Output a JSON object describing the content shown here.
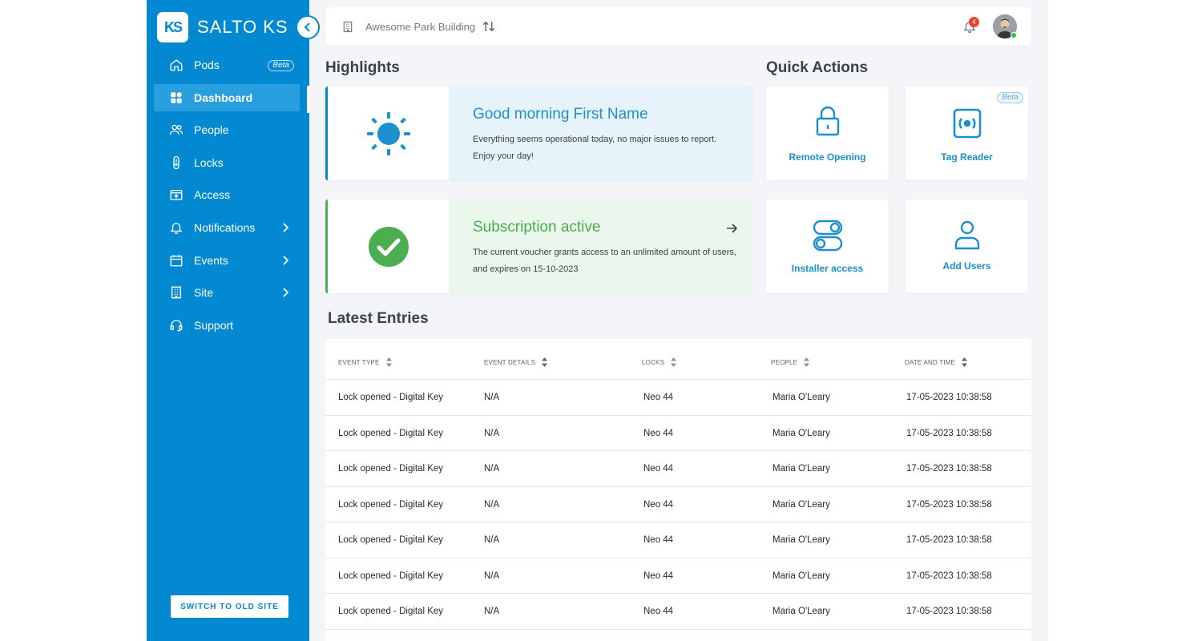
{
  "brand": {
    "logo_mark": "KS",
    "name": "SALTO KS"
  },
  "sidebar": {
    "items": [
      {
        "label": "Pods",
        "icon": "home-icon",
        "badge": "Beta"
      },
      {
        "label": "Dashboard",
        "icon": "dashboard-icon",
        "active": true
      },
      {
        "label": "People",
        "icon": "people-icon"
      },
      {
        "label": "Locks",
        "icon": "lock-device-icon"
      },
      {
        "label": "Access",
        "icon": "access-icon"
      },
      {
        "label": "Notifications",
        "icon": "bell-icon",
        "has_submenu": true
      },
      {
        "label": "Events",
        "icon": "calendar-icon",
        "has_submenu": true
      },
      {
        "label": "Site",
        "icon": "building-icon",
        "has_submenu": true
      },
      {
        "label": "Support",
        "icon": "headset-icon"
      }
    ],
    "old_site_label": "SWITCH TO OLD SITE"
  },
  "topbar": {
    "building": "Awesome Park Building",
    "notification_count": "4"
  },
  "highlights": {
    "title": "Highlights",
    "morning": {
      "title": "Good morning First Name",
      "line1": "Everything seems operational today, no major issues to report.",
      "line2": "Enjoy your day!"
    },
    "subscription": {
      "title": "Subscription active",
      "line1": "The current voucher grants access to an unlimited amount of users,",
      "line2": "and expires on 15-10-2023"
    }
  },
  "quick_actions": {
    "title": "Quick Actions",
    "items": [
      {
        "label": "Remote Opening",
        "icon": "padlock-icon"
      },
      {
        "label": "Tag Reader",
        "icon": "tag-reader-icon",
        "badge": "Beta"
      },
      {
        "label": "Installer access",
        "icon": "toggle-icon"
      },
      {
        "label": "Add Users",
        "icon": "user-icon"
      }
    ]
  },
  "entries": {
    "title": "Latest Entries",
    "columns": [
      "EVENT TYPE",
      "EVENT DETAILS",
      "LOCKS",
      "PEOPLE",
      "DATE AND TIME"
    ],
    "rows": [
      [
        "Lock opened - Digital Key",
        "N/A",
        "Neo 44",
        "Maria O'Leary",
        "17-05-2023 10:38:58"
      ],
      [
        "Lock opened - Digital Key",
        "N/A",
        "Neo 44",
        "Maria O'Leary",
        "17-05-2023 10:38:58"
      ],
      [
        "Lock opened - Digital Key",
        "N/A",
        "Neo 44",
        "Maria O'Leary",
        "17-05-2023 10:38:58"
      ],
      [
        "Lock opened - Digital Key",
        "N/A",
        "Neo 44",
        "Maria O'Leary",
        "17-05-2023 10:38:58"
      ],
      [
        "Lock opened - Digital Key",
        "N/A",
        "Neo 44",
        "Maria O'Leary",
        "17-05-2023 10:38:58"
      ],
      [
        "Lock opened - Digital Key",
        "N/A",
        "Neo 44",
        "Maria O'Leary",
        "17-05-2023 10:38:58"
      ],
      [
        "Lock opened - Digital Key",
        "N/A",
        "Neo 44",
        "Maria O'Leary",
        "17-05-2023 10:38:58"
      ]
    ]
  },
  "colors": {
    "primary": "#0289d1",
    "success": "#4cae50",
    "badge": "#e8412c",
    "online": "#31c04a"
  }
}
